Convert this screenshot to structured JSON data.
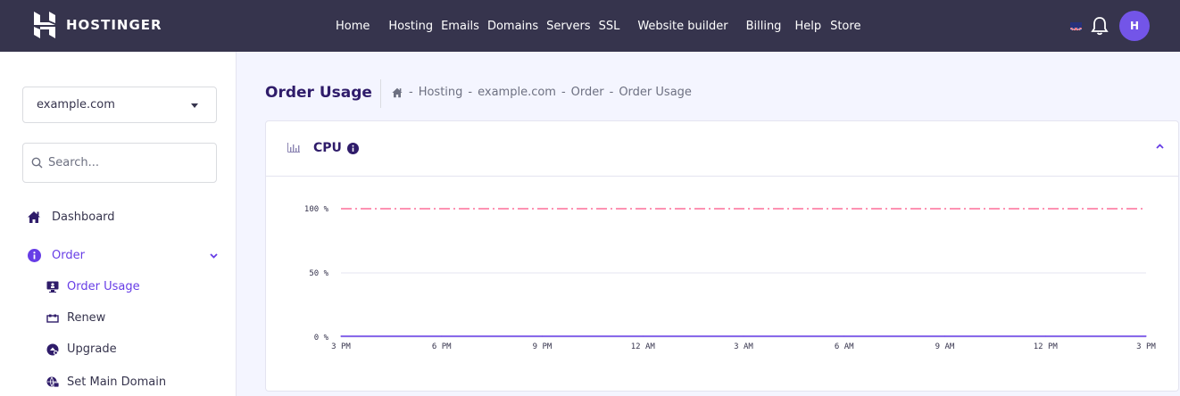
{
  "brand": {
    "name": "HOSTINGER",
    "avatar_text": "H"
  },
  "nav": [
    "Home",
    "Hosting",
    "Emails",
    "Domains",
    "Servers",
    "SSL",
    "Website builder",
    "Billing",
    "Help",
    "Store"
  ],
  "sidebar": {
    "domain": "example.com",
    "search_placeholder": "Search...",
    "items": [
      {
        "label": "Dashboard",
        "icon": "home-icon"
      },
      {
        "label": "Order",
        "icon": "info-circle-icon",
        "active": true,
        "expanded": true
      }
    ],
    "subitems": [
      {
        "label": "Order Usage",
        "icon": "monitor-icon",
        "active": true
      },
      {
        "label": "Renew",
        "icon": "renew-icon"
      },
      {
        "label": "Upgrade",
        "icon": "upgrade-icon"
      },
      {
        "label": "Set Main Domain",
        "icon": "globe-icon"
      }
    ]
  },
  "page": {
    "title": "Order Usage",
    "breadcrumb": [
      "Hosting",
      "example.com",
      "Order",
      "Order Usage"
    ]
  },
  "card": {
    "title": "CPU"
  },
  "colors": {
    "accent": "#673de6",
    "topbar": "#36344d",
    "limit_line": "#fc5185",
    "series": "#673de6"
  },
  "chart_data": {
    "type": "line",
    "title": "CPU",
    "x": [
      "3 PM",
      "6 PM",
      "9 PM",
      "12 AM",
      "3 AM",
      "6 AM",
      "9 AM",
      "12 PM",
      "3 PM"
    ],
    "y_ticks": [
      "100 %",
      "50 %",
      "0 %"
    ],
    "ylim": [
      0,
      100
    ],
    "series": [
      {
        "values": [
          0,
          0,
          0,
          0,
          0,
          0,
          0,
          0,
          0
        ]
      }
    ],
    "limit": 100,
    "grid": true
  }
}
